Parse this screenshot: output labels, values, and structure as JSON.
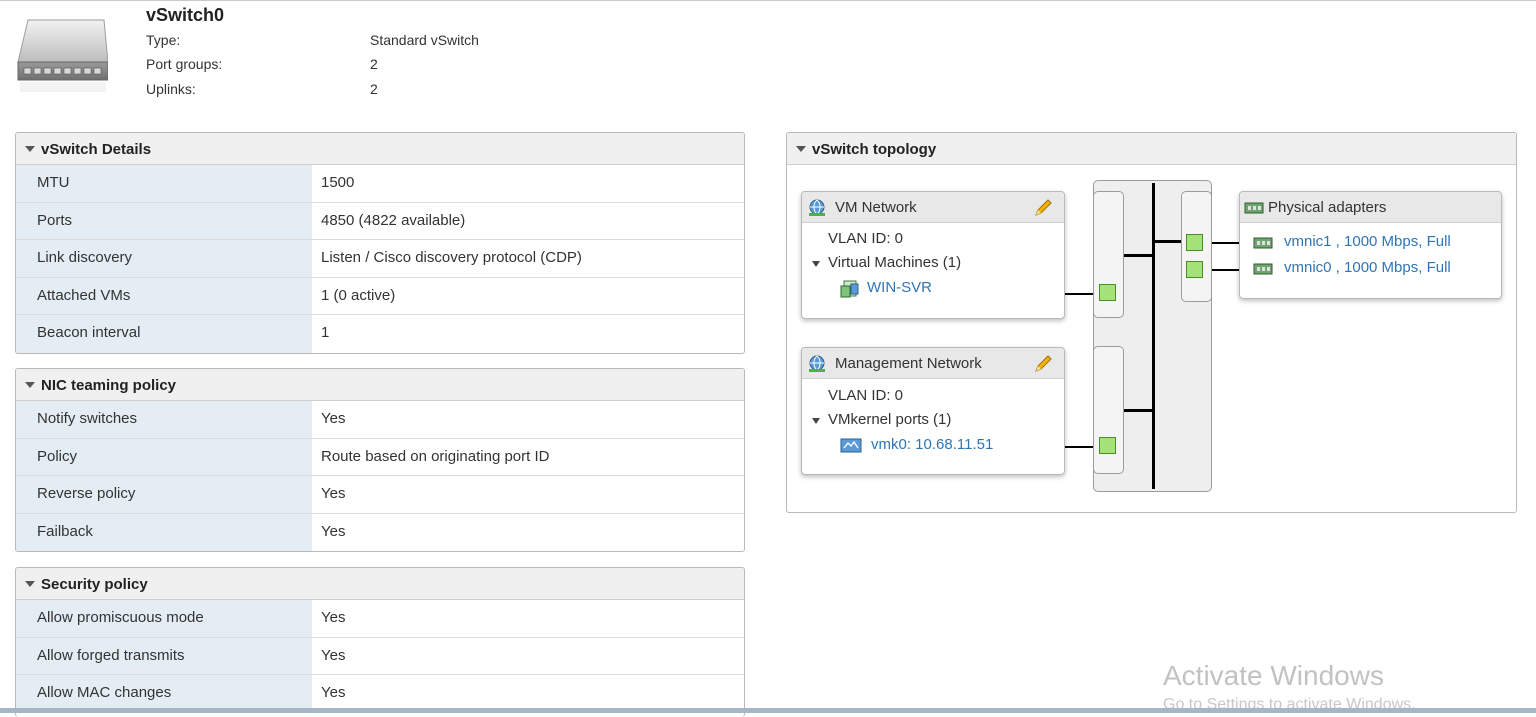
{
  "header": {
    "title": "vSwitch0",
    "rows": [
      {
        "label": "Type:",
        "value": "Standard vSwitch"
      },
      {
        "label": "Port groups:",
        "value": "2"
      },
      {
        "label": "Uplinks:",
        "value": "2"
      }
    ]
  },
  "details": {
    "title": "vSwitch Details",
    "rows": [
      {
        "label": "MTU",
        "value": "1500"
      },
      {
        "label": "Ports",
        "value": "4850 (4822 available)"
      },
      {
        "label": "Link discovery",
        "value": "Listen / Cisco discovery protocol (CDP)"
      },
      {
        "label": "Attached VMs",
        "value": "1 (0 active)"
      },
      {
        "label": "Beacon interval",
        "value": "1"
      }
    ]
  },
  "nic_teaming": {
    "title": "NIC teaming policy",
    "rows": [
      {
        "label": "Notify switches",
        "value": "Yes"
      },
      {
        "label": "Policy",
        "value": "Route based on originating port ID"
      },
      {
        "label": "Reverse policy",
        "value": "Yes"
      },
      {
        "label": "Failback",
        "value": "Yes"
      }
    ]
  },
  "security": {
    "title": "Security policy",
    "rows": [
      {
        "label": "Allow promiscuous mode",
        "value": "Yes"
      },
      {
        "label": "Allow forged transmits",
        "value": "Yes"
      },
      {
        "label": "Allow MAC changes",
        "value": "Yes"
      }
    ]
  },
  "topology": {
    "title": "vSwitch topology",
    "vm_network": {
      "name": "VM Network",
      "vlan": "VLAN ID: 0",
      "group_label": "Virtual Machines (1)",
      "vm": "WIN-SVR"
    },
    "mgmt_network": {
      "name": "Management Network",
      "vlan": "VLAN ID: 0",
      "group_label": "VMkernel ports (1)",
      "vmk": "vmk0: 10.68.11.51"
    },
    "physical": {
      "title": "Physical adapters",
      "nics": [
        "vmnic1 , 1000 Mbps, Full",
        "vmnic0 , 1000 Mbps, Full"
      ]
    }
  },
  "watermark": {
    "line1": "Activate Windows",
    "line2": "Go to Settings to activate Windows."
  }
}
